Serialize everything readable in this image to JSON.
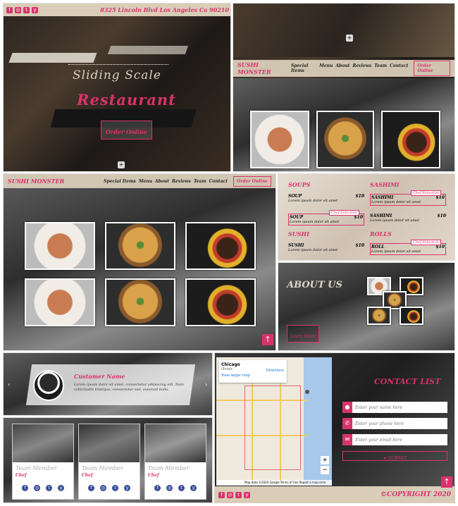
{
  "hero": {
    "address": "8325 Lincoln Blvd Los Angeles Ca 90210",
    "title_line1": "Sliding Scale",
    "title_line2": "Restaurant",
    "order_button": "Order Online",
    "plus": "+"
  },
  "nav": {
    "brand": "SUSHI MONSTER",
    "links": [
      "Special Items",
      "Menu",
      "About",
      "Reviews",
      "Team",
      "Contact"
    ],
    "links_short": [
      "Special Items",
      "Menu",
      "About",
      "Reviews",
      "Team",
      "Contact"
    ],
    "order_button": "Order Online"
  },
  "menu": {
    "sections": [
      {
        "name": "SOUPS",
        "items": [
          {
            "name": "SOUP",
            "price": "$10",
            "desc": "Lorem ipsum dolor sit amet",
            "badge": ""
          },
          {
            "name": "SOUP",
            "price": "$10",
            "desc": "Lorem ipsum dolor sit amet",
            "badge": "Chef Selection"
          }
        ]
      },
      {
        "name": "SASHIMI",
        "items": [
          {
            "name": "SASHIMI",
            "price": "$10",
            "desc": "Lorem ipsum dolor sit amet",
            "badge": "Chef Selection"
          },
          {
            "name": "SASHIMI",
            "price": "$10",
            "desc": "Lorem ipsum dolor sit amet",
            "badge": ""
          }
        ]
      },
      {
        "name": "SUSHI",
        "items": [
          {
            "name": "SUSHI",
            "price": "$10",
            "desc": "Lorem ipsum dolor sit amet",
            "badge": ""
          }
        ]
      },
      {
        "name": "ROLLS",
        "items": [
          {
            "name": "ROLL",
            "price": "$10",
            "desc": "Lorem ipsum dolor sit amet",
            "badge": "Chef Selection"
          }
        ]
      }
    ]
  },
  "about": {
    "title": "ABOUT US",
    "button": "Learn More"
  },
  "review": {
    "name": "Customer Name",
    "text": "Lorem ipsum dolor sit amet, consectetur adipiscing elit. Nam sollicitudin tristique, consectetur sed, euismod nulla."
  },
  "team": {
    "members": [
      {
        "name": "Team Member",
        "role": "Chef"
      },
      {
        "name": "Team Member",
        "role": "Chef"
      },
      {
        "name": "Team Member",
        "role": "Chef"
      }
    ]
  },
  "map": {
    "place": "Chicago",
    "region": "Illinois",
    "directions": "Directions",
    "larger_map": "View larger map",
    "footer_text": "Map data ©2020 Google  Terms of Use  Report a map error"
  },
  "contact": {
    "title": "CONTACT LIST",
    "name_placeholder": "Enter your name here",
    "phone_placeholder": "Enter your phone here",
    "email_placeholder": "Enter your email here",
    "submit": "SUBMIT"
  },
  "footer": {
    "copyright": "©COPYRIGHT 2020"
  },
  "colors": {
    "accent": "#d9336b",
    "beige": "#d9cdb8"
  }
}
